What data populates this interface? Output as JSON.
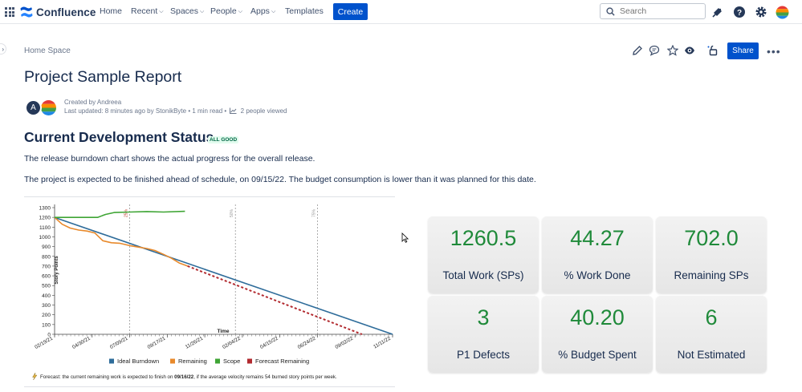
{
  "nav": {
    "product": "Confluence",
    "items": [
      {
        "label": "Home",
        "dropdown": false
      },
      {
        "label": "Recent",
        "dropdown": true
      },
      {
        "label": "Spaces",
        "dropdown": true
      },
      {
        "label": "People",
        "dropdown": true
      },
      {
        "label": "Apps",
        "dropdown": true
      },
      {
        "label": "Templates",
        "dropdown": false
      }
    ],
    "create_label": "Create",
    "search_placeholder": "Search",
    "icons": [
      "notifications-icon",
      "help-icon",
      "settings-icon",
      "user-avatar"
    ]
  },
  "page": {
    "breadcrumb": "Home Space",
    "title": "Project Sample Report",
    "share_label": "Share",
    "more_label": "•••",
    "author_initial": "A",
    "created_by": "Created by Andreea",
    "last_updated": "Last updated: 8 minutes ago by StonikByte",
    "read_time": "1 min read",
    "views": "2 people viewed"
  },
  "content": {
    "section_title": "Current Development Status",
    "status": "ALL GOOD",
    "para1": "The release burndown chart shows the actual progress for the overall release.",
    "para2": "The project is expected to be finished ahead of schedule, on 09/15/22. The budget consumption is lower than it was planned for this date."
  },
  "chart_data": {
    "type": "line",
    "ylabel": "Story Points",
    "xlabel": "Time",
    "ylim": [
      0,
      1300
    ],
    "yticks": [
      0,
      100,
      200,
      300,
      400,
      500,
      600,
      700,
      800,
      900,
      1000,
      1100,
      1200,
      1300
    ],
    "xlim": [
      "02/19/21",
      "11/11/22"
    ],
    "xticks": [
      "02/19/21",
      "04/30/21",
      "07/09/21",
      "09/17/21",
      "11/26/21",
      "02/04/22",
      "04/15/22",
      "06/24/22",
      "09/02/22",
      "11/11/22"
    ],
    "markers": [
      {
        "label": "25%",
        "x": "07/09/21"
      },
      {
        "label": "50%",
        "x": "01/22/22"
      },
      {
        "label": "75%",
        "x": "06/24/22"
      }
    ],
    "series": [
      {
        "name": "Ideal Burndown",
        "color": "#2e6c9a",
        "points": [
          [
            "02/19/21",
            1200
          ],
          [
            "11/11/22",
            0
          ]
        ]
      },
      {
        "name": "Remaining",
        "color": "#e8892b",
        "points": [
          [
            "02/19/21",
            1200
          ],
          [
            "03/05/21",
            1130
          ],
          [
            "03/20/21",
            1090
          ],
          [
            "04/05/21",
            1070
          ],
          [
            "04/20/21",
            1060
          ],
          [
            "05/05/21",
            1040
          ],
          [
            "05/20/21",
            960
          ],
          [
            "06/05/21",
            940
          ],
          [
            "06/20/21",
            935
          ],
          [
            "07/09/21",
            910
          ],
          [
            "07/25/21",
            895
          ],
          [
            "08/10/21",
            880
          ],
          [
            "08/25/21",
            860
          ],
          [
            "09/10/21",
            820
          ],
          [
            "09/25/21",
            780
          ],
          [
            "10/10/21",
            730
          ],
          [
            "10/25/21",
            700
          ]
        ]
      },
      {
        "name": "Scope",
        "color": "#3fa535",
        "points": [
          [
            "02/19/21",
            1200
          ],
          [
            "05/10/21",
            1200
          ],
          [
            "05/25/21",
            1230
          ],
          [
            "06/10/21",
            1250
          ],
          [
            "07/09/21",
            1255
          ],
          [
            "08/10/21",
            1260
          ],
          [
            "09/10/21",
            1255
          ],
          [
            "10/20/21",
            1262
          ]
        ]
      },
      {
        "name": "Forecast Remaining",
        "color": "#b22a2f",
        "dashed": true,
        "points": [
          [
            "10/25/21",
            700
          ],
          [
            "09/15/22",
            0
          ]
        ]
      }
    ],
    "legend_position": "bottom",
    "footnote_prefix": "Forecast: the current remaining work is expected to finish on ",
    "footnote_date": "09/16/22",
    "footnote_suffix": ", if the average velocity remains 54 burned story points per week."
  },
  "metrics": [
    {
      "value": "1260.5",
      "label": "Total Work (SPs)"
    },
    {
      "value": "44.27",
      "label": "% Work Done"
    },
    {
      "value": "702.0",
      "label": "Remaining SPs"
    },
    {
      "value": "3",
      "label": "P1 Defects"
    },
    {
      "value": "40.20",
      "label": "% Budget Spent"
    },
    {
      "value": "6",
      "label": "Not Estimated"
    }
  ],
  "colors": {
    "accent": "#0052cc",
    "metric_value": "#1f8a3a",
    "status_bg": "#e3fcef",
    "status_text": "#006644"
  }
}
